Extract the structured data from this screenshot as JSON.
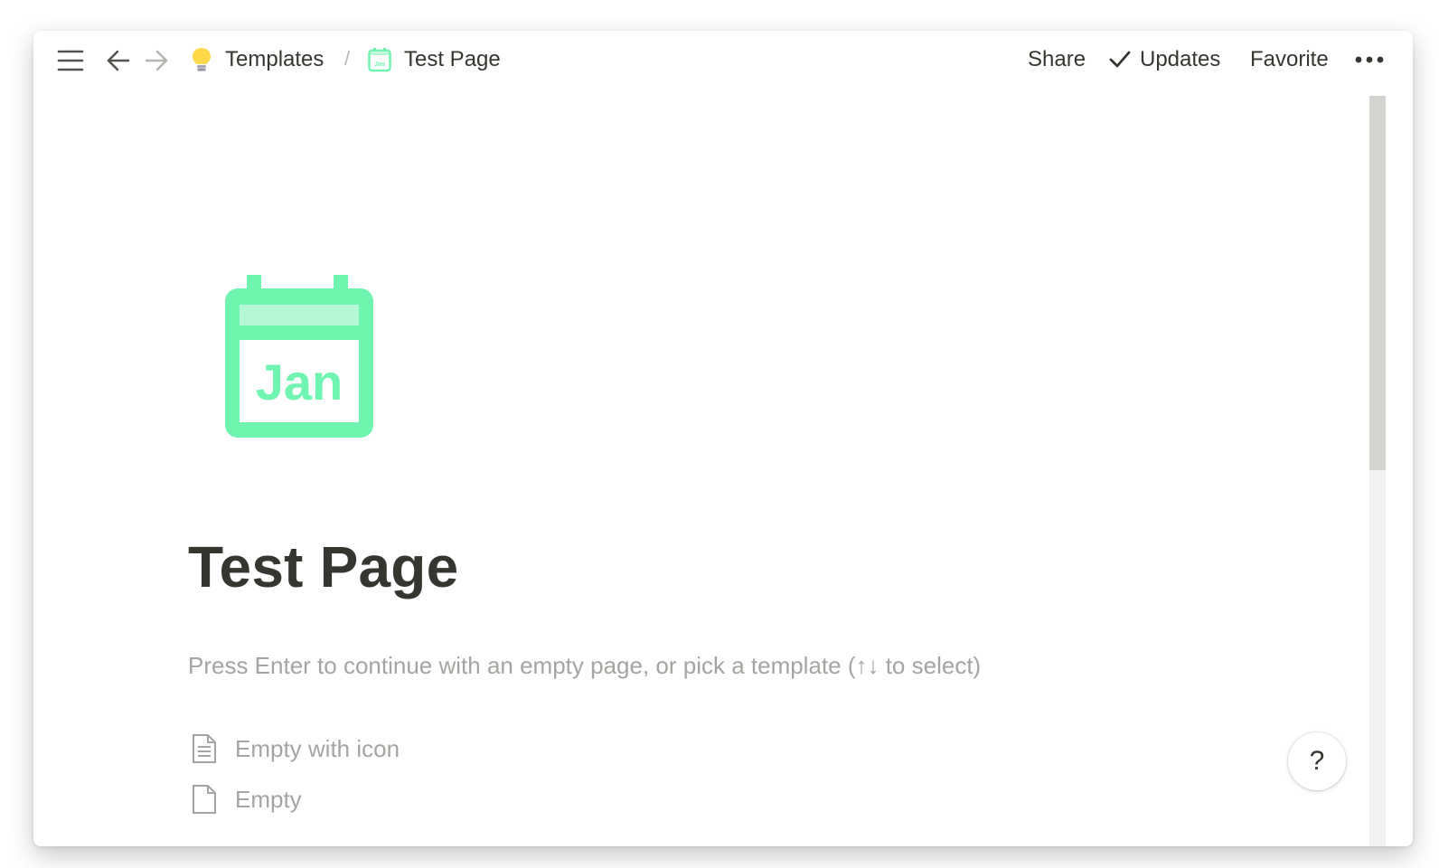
{
  "topbar": {
    "menu_icon": "hamburger-menu-icon",
    "back_icon": "arrow-left-icon",
    "forward_icon": "arrow-right-icon",
    "breadcrumb": [
      {
        "label": "Templates",
        "icon": "lightbulb-icon"
      },
      {
        "label": "Test Page",
        "icon": "calendar-jan-icon"
      }
    ],
    "separator": "/",
    "share_label": "Share",
    "updates_label": "Updates",
    "favorite_label": "Favorite",
    "more_icon": "more-horizontal-icon"
  },
  "page": {
    "icon": "calendar-jan-icon",
    "icon_text": "Jan",
    "icon_color": "#6ff5b0",
    "title": "Test Page",
    "hint": "Press Enter to continue with an empty page, or pick a template (↑↓ to select)"
  },
  "templates": [
    {
      "label": "Empty with icon",
      "icon": "document-lines-icon"
    },
    {
      "label": "Empty",
      "icon": "document-blank-icon"
    }
  ],
  "help_label": "?"
}
